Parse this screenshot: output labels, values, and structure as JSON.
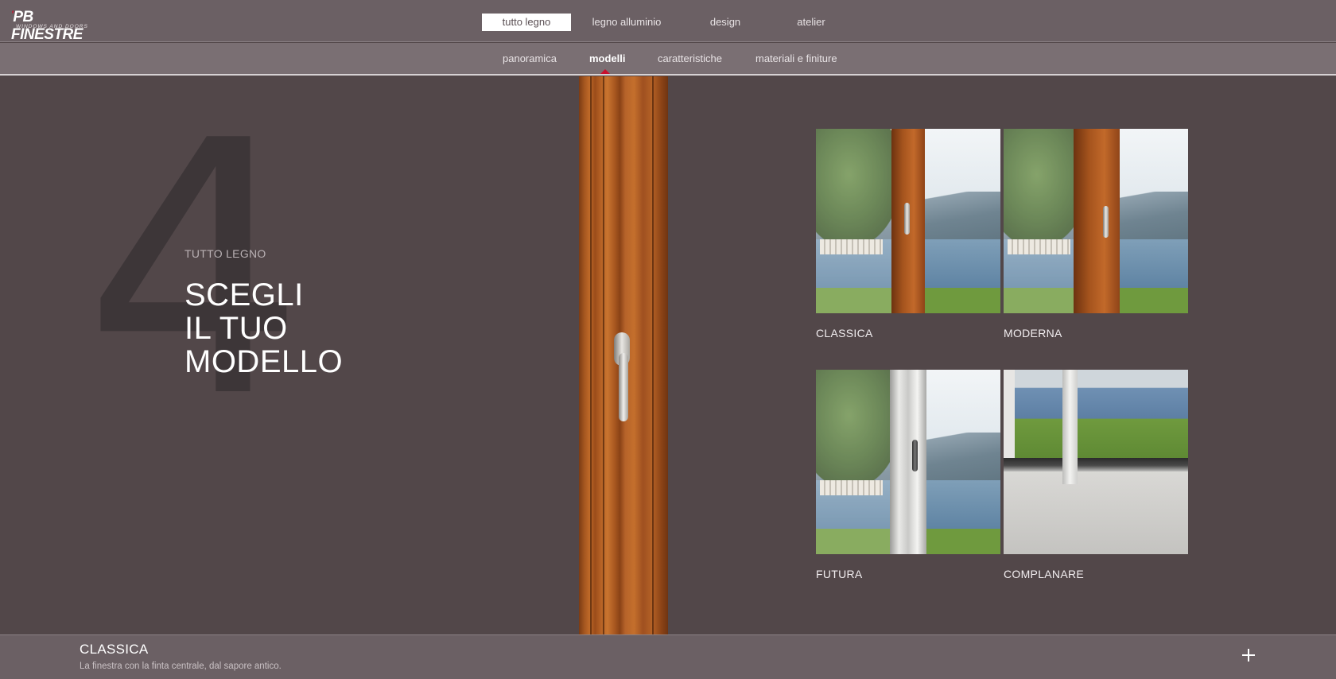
{
  "brand": {
    "name": "PB FINESTRE",
    "tagline": "WINDOWS AND DOORS"
  },
  "topnav": [
    {
      "label": "tutto legno",
      "active": true
    },
    {
      "label": "legno alluminio",
      "active": false
    },
    {
      "label": "design",
      "active": false
    },
    {
      "label": "atelier",
      "active": false
    }
  ],
  "subnav": [
    {
      "label": "panoramica",
      "active": false
    },
    {
      "label": "modelli",
      "active": true
    },
    {
      "label": "caratteristiche",
      "active": false
    },
    {
      "label": "materiali e finiture",
      "active": false
    }
  ],
  "hero": {
    "number": "4",
    "kicker": "TUTTO LEGNO",
    "headline": [
      "SCEGLI",
      "IL TUO",
      "MODELLO"
    ]
  },
  "models": [
    {
      "label": "CLASSICA",
      "finish": "wood"
    },
    {
      "label": "MODERNA",
      "finish": "wood"
    },
    {
      "label": "FUTURA",
      "finish": "white"
    },
    {
      "label": "COMPLANARE",
      "finish": "white"
    }
  ],
  "selected": {
    "title": "CLASSICA",
    "description": "La finestra con la finta centrale, dal sapore antico."
  },
  "colors": {
    "accent": "#c8102e",
    "background": "#524749",
    "bar": "#6b6064"
  }
}
